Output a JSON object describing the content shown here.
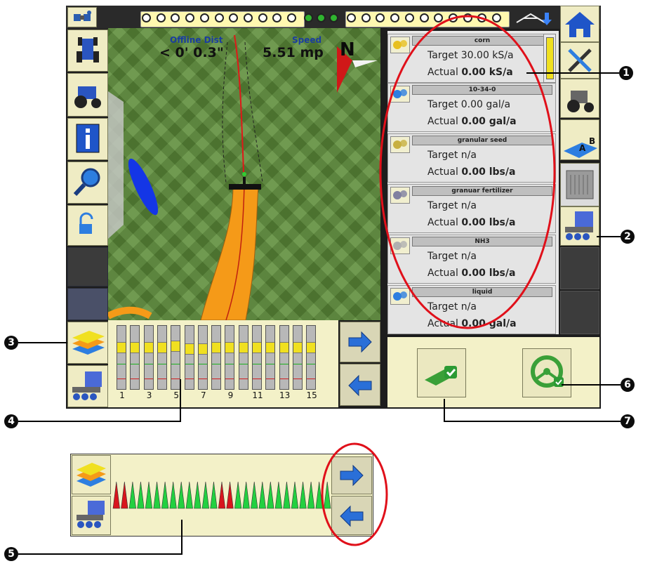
{
  "telemetry": {
    "offline_label": "Offline Dist",
    "offline_value": "< 0' 0.3\"",
    "speed_label": "Speed",
    "speed_value": "5.51 mp",
    "north_label": "N"
  },
  "products": [
    {
      "name": "corn",
      "target_label": "Target",
      "target_value": "30.00 kS/a",
      "actual_label": "Actual",
      "actual_value": "0.00 kS/a",
      "icon": "corn-seed-icon"
    },
    {
      "name": "10-34-0",
      "target_label": "Target",
      "target_value": "0.00 gal/a",
      "actual_label": "Actual",
      "actual_value": "0.00 gal/a",
      "icon": "liquid-drops-icon"
    },
    {
      "name": "granular seed",
      "target_label": "Target",
      "target_value": "n/a",
      "actual_label": "Actual",
      "actual_value": "0.00 lbs/a",
      "icon": "granular-seed-icon"
    },
    {
      "name": "granuar fertilizer",
      "target_label": "Target",
      "target_value": "n/a",
      "actual_label": "Actual",
      "actual_value": "0.00 lbs/a",
      "icon": "granular-fertilizer-icon"
    },
    {
      "name": "NH3",
      "target_label": "Target",
      "target_value": "n/a",
      "actual_label": "Actual",
      "actual_value": "0.00 lbs/a",
      "icon": "nh3-tank-icon"
    },
    {
      "name": "liquid",
      "target_label": "Target",
      "target_value": "n/a",
      "actual_label": "Actual",
      "actual_value": "0.00 gal/a",
      "icon": "liquid-drops-icon"
    }
  ],
  "sections": {
    "count": 15,
    "labels": [
      "1",
      "3",
      "5",
      "7",
      "9",
      "11",
      "13",
      "15"
    ]
  },
  "strip_sections": [
    "red",
    "red",
    "green",
    "green",
    "green",
    "green",
    "green",
    "green",
    "green",
    "green",
    "green",
    "green",
    "green",
    "red",
    "red",
    "green",
    "green",
    "green",
    "green",
    "green",
    "green",
    "green",
    "green",
    "green",
    "green",
    "green",
    "green"
  ],
  "callouts": {
    "c1": "1",
    "c2": "2",
    "c3": "3",
    "c4": "4",
    "c5": "5",
    "c6": "6",
    "c7": "7"
  },
  "colors": {
    "highlight_ellipse": "#e0101a",
    "section_on": "#22d040",
    "section_off": "#d8151d",
    "arrow_blue": "#2a6fd8"
  }
}
